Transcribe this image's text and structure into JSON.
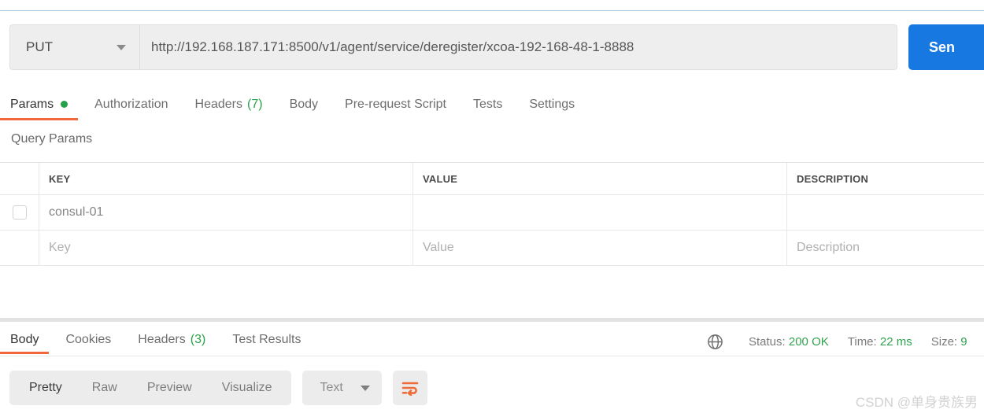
{
  "request": {
    "method": "PUT",
    "url": "http://192.168.187.171:8500/v1/agent/service/deregister/xcoa-192-168-48-1-8888",
    "send_label": "Sen",
    "tabs": [
      {
        "label": "Params",
        "badge": "",
        "dot": true,
        "active": true
      },
      {
        "label": "Authorization",
        "badge": "",
        "dot": false,
        "active": false
      },
      {
        "label": "Headers",
        "badge": "(7)",
        "dot": false,
        "active": false
      },
      {
        "label": "Body",
        "badge": "",
        "dot": false,
        "active": false
      },
      {
        "label": "Pre-request Script",
        "badge": "",
        "dot": false,
        "active": false
      },
      {
        "label": "Tests",
        "badge": "",
        "dot": false,
        "active": false
      },
      {
        "label": "Settings",
        "badge": "",
        "dot": false,
        "active": false
      }
    ]
  },
  "query_params": {
    "title": "Query Params",
    "columns": {
      "key": "KEY",
      "value": "VALUE",
      "description": "DESCRIPTION"
    },
    "rows": [
      {
        "checked": false,
        "key": "consul-01",
        "value": "",
        "description": ""
      }
    ],
    "placeholder_row": {
      "key": "Key",
      "value": "Value",
      "description": "Description"
    }
  },
  "response": {
    "tabs": [
      {
        "label": "Body",
        "badge": "",
        "active": true
      },
      {
        "label": "Cookies",
        "badge": "",
        "active": false
      },
      {
        "label": "Headers",
        "badge": "(3)",
        "active": false
      },
      {
        "label": "Test Results",
        "badge": "",
        "active": false
      }
    ],
    "meta": {
      "globe_icon": "globe-icon",
      "status_label": "Status:",
      "status_value": "200 OK",
      "time_label": "Time:",
      "time_value": "22 ms",
      "size_label": "Size:",
      "size_value": "9"
    },
    "view_modes": [
      {
        "label": "Pretty",
        "active": true
      },
      {
        "label": "Raw",
        "active": false
      },
      {
        "label": "Preview",
        "active": false
      },
      {
        "label": "Visualize",
        "active": false
      }
    ],
    "format_select": "Text",
    "wrap_icon": "word-wrap-icon"
  },
  "watermark": "CSDN @单身贵族男",
  "colors": {
    "accent_orange": "#f1663a",
    "send_blue": "#1678e0",
    "status_green": "#2fa34f",
    "dot_green": "#27a04a"
  }
}
